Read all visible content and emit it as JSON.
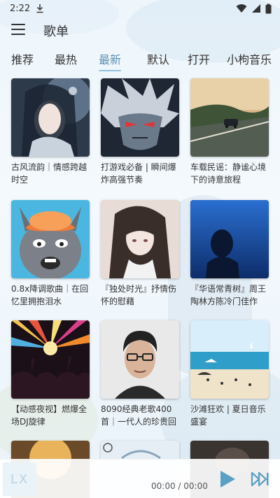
{
  "status_bar": {
    "time": "2:22",
    "download_icon": "download-icon",
    "wifi_icon": "wifi-icon",
    "signal_icon": "signal-icon",
    "battery_icon": "battery-icon"
  },
  "header": {
    "menu_icon": "menu-icon",
    "title": "歌单"
  },
  "tabs": [
    {
      "label": "推荐",
      "active": false
    },
    {
      "label": "最热",
      "active": false
    },
    {
      "label": "最新",
      "active": true
    },
    {
      "label": "默认",
      "active": false
    },
    {
      "label": "打开",
      "active": false
    },
    {
      "label": "小枸音乐",
      "active": false
    }
  ],
  "playlists": [
    {
      "title": "古风流韵｜情感跨越时空"
    },
    {
      "title": "打游戏必备 | 瞬间爆炸高强节奏"
    },
    {
      "title": "车载民谣：静谧心境下的诗意旅程"
    },
    {
      "title": "0.8x降调歌曲｜在回忆里拥抱泪水"
    },
    {
      "title": "『独处时光』抒情伤怀的慰藉"
    },
    {
      "title": "『华语常青树』周王陶林方陈冷门佳作"
    },
    {
      "title": "【动感夜视】燃爆全场DJ旋律"
    },
    {
      "title": "8090经典老歌400首｜一代人的珍贵回忆"
    },
    {
      "title": "沙滩狂欢 | 夏日音乐盛宴"
    }
  ],
  "player": {
    "cover_logo": "LX",
    "time": "00:00 / 00:00",
    "play_icon": "play-icon",
    "next_icon": "skip-next-icon"
  },
  "colors": {
    "accent": "#5b8fb0",
    "tab_underline": "#8fc2dd",
    "control": "#5a9fc4"
  }
}
